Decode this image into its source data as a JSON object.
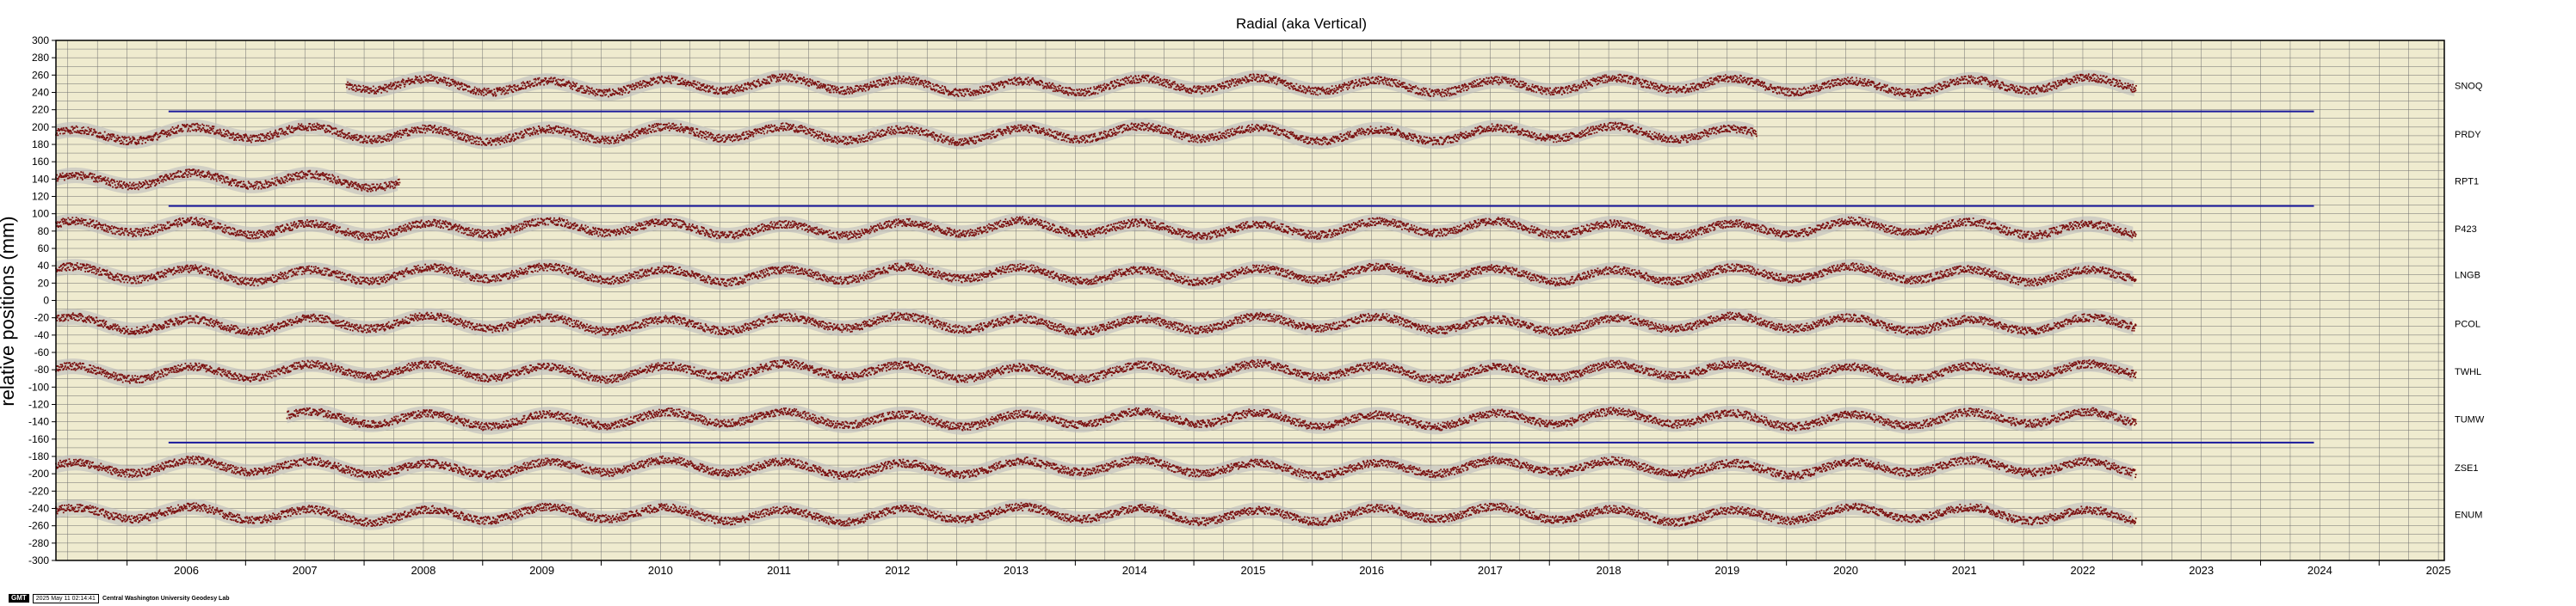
{
  "chart_data": {
    "type": "scatter",
    "title": "Radial (aka Vertical)",
    "ylabel": "relative positions (mm)",
    "xlabel": "",
    "xlim": [
      2005.4,
      2025.55
    ],
    "ylim": [
      -300,
      300
    ],
    "y_ticks": [
      300,
      280,
      260,
      240,
      220,
      200,
      180,
      160,
      140,
      120,
      100,
      80,
      60,
      40,
      20,
      0,
      -20,
      -40,
      -60,
      -80,
      -100,
      -120,
      -140,
      -160,
      -180,
      -200,
      -220,
      -240,
      -260,
      -280,
      -300
    ],
    "x_ticks": [
      "2006",
      "2007",
      "2008",
      "2009",
      "2010",
      "2011",
      "2012",
      "2013",
      "2014",
      "2015",
      "2016",
      "2017",
      "2018",
      "2019",
      "2020",
      "2021",
      "2022",
      "2023",
      "2024",
      "2025"
    ],
    "grid": true,
    "reference_lines": [
      {
        "y": 218,
        "x": [
          2006.35,
          2024.45
        ]
      },
      {
        "y": 109,
        "x": [
          2006.35,
          2024.45
        ]
      },
      {
        "y": -164,
        "x": [
          2006.35,
          2024.45
        ]
      }
    ],
    "series": [
      {
        "name": "SNOQ",
        "offset": 248,
        "x": [
          2007.85,
          2022.95
        ]
      },
      {
        "name": "PRDY",
        "offset": 192,
        "x": [
          2005.4,
          2019.75
        ]
      },
      {
        "name": "RPT1",
        "offset": 138,
        "x": [
          2005.4,
          2008.3
        ]
      },
      {
        "name": "P423",
        "offset": 83,
        "x": [
          2005.4,
          2022.95
        ]
      },
      {
        "name": "LNGB",
        "offset": 30,
        "x": [
          2005.4,
          2022.95
        ]
      },
      {
        "name": "PCOL",
        "offset": -27,
        "x": [
          2005.4,
          2022.95
        ]
      },
      {
        "name": "TWHL",
        "offset": -82,
        "x": [
          2005.4,
          2022.95
        ]
      },
      {
        "name": "TUMW",
        "offset": -137,
        "x": [
          2007.35,
          2022.95
        ]
      },
      {
        "name": "ZSE1",
        "offset": -193,
        "x": [
          2005.4,
          2022.95
        ]
      },
      {
        "name": "ENUM",
        "offset": -247,
        "x": [
          2005.4,
          2022.95
        ]
      }
    ]
  },
  "colors": {
    "plot_bg": "#efebcf",
    "grid": "#6f6f6f",
    "points": "#7a1010",
    "error_band": "#bdbdbd",
    "ref_line": "#1a1a9c"
  },
  "footer": {
    "logo": "GMT",
    "timestamp": "2025 May 11 02:14:41",
    "credit": "Central Washington University Geodesy Lab"
  }
}
